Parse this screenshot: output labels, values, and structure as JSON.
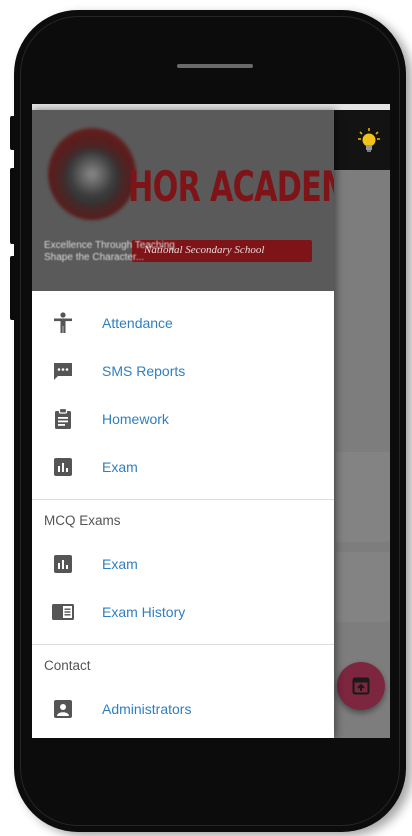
{
  "header": {
    "school_name": "HOR ACADEMY",
    "subtitle": "National Secondary School",
    "tagline_line1": "Excellence Through Teaching",
    "tagline_line2": "Shape the Character..."
  },
  "menu": {
    "main_items": [
      {
        "label": "Attendance",
        "icon": "person-icon"
      },
      {
        "label": "SMS Reports",
        "icon": "message-icon"
      },
      {
        "label": "Homework",
        "icon": "clipboard-icon"
      },
      {
        "label": "Exam",
        "icon": "bar-chart-icon"
      }
    ],
    "mcq_section_title": "MCQ Exams",
    "mcq_items": [
      {
        "label": "Exam",
        "icon": "bar-chart-icon"
      },
      {
        "label": "Exam History",
        "icon": "reader-icon"
      }
    ],
    "contact_section_title": "Contact",
    "contact_items": [
      {
        "label": "Administrators",
        "icon": "contact-card-icon"
      }
    ]
  },
  "colors": {
    "menu_label": "#2e7fc1",
    "icon": "#555555",
    "fab": "#7c2640",
    "brand_red": "#7e1418"
  }
}
